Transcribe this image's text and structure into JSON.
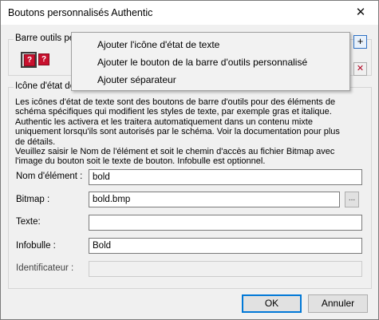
{
  "window": {
    "title": "Boutons personnalisés Authentic",
    "close_glyph": "✕"
  },
  "toolbar_group": {
    "label": "Barre outils personnalisée",
    "icons": [
      "text-state-icon",
      "text-state-icon"
    ],
    "add_glyph": "+",
    "delete_glyph": "✕"
  },
  "context_menu": {
    "items": [
      {
        "label": "Ajouter l'icône d'état de texte"
      },
      {
        "label": "Ajouter le bouton de la barre d'outils personnalisé"
      },
      {
        "label": "Ajouter séparateur"
      }
    ]
  },
  "state_group": {
    "label": "Icône d'état de texte",
    "description": "Les icônes d'état de texte sont des boutons de barre d'outils pour des éléments de schéma spécifiques qui modifient les styles de texte, par exemple gras et italique. Authentic les activera et les traitera automatiquement dans un contenu mixte uniquement lorsqu'ils sont autorisés par le schéma. Voir la documentation pour plus de détails.\nVeuillez saisir le Nom de l'élément et soit le chemin d'accès au fichier Bitmap avec l'image du bouton soit le texte de bouton. Infobulle est optionnel."
  },
  "form": {
    "element_name": {
      "label": "Nom d'élément :",
      "value": "bold"
    },
    "bitmap": {
      "label": "Bitmap :",
      "value": "bold.bmp",
      "browse": "..."
    },
    "text": {
      "label": "Texte:",
      "value": ""
    },
    "tooltip": {
      "label": "Infobulle :",
      "value": "Bold"
    },
    "identifier": {
      "label": "Identificateur :",
      "value": ""
    }
  },
  "buttons": {
    "ok": "OK",
    "cancel": "Annuler"
  },
  "colors": {
    "accent": "#0078d7",
    "icon_red": "#c8102e",
    "menu_bg": "#f2f2f2"
  }
}
